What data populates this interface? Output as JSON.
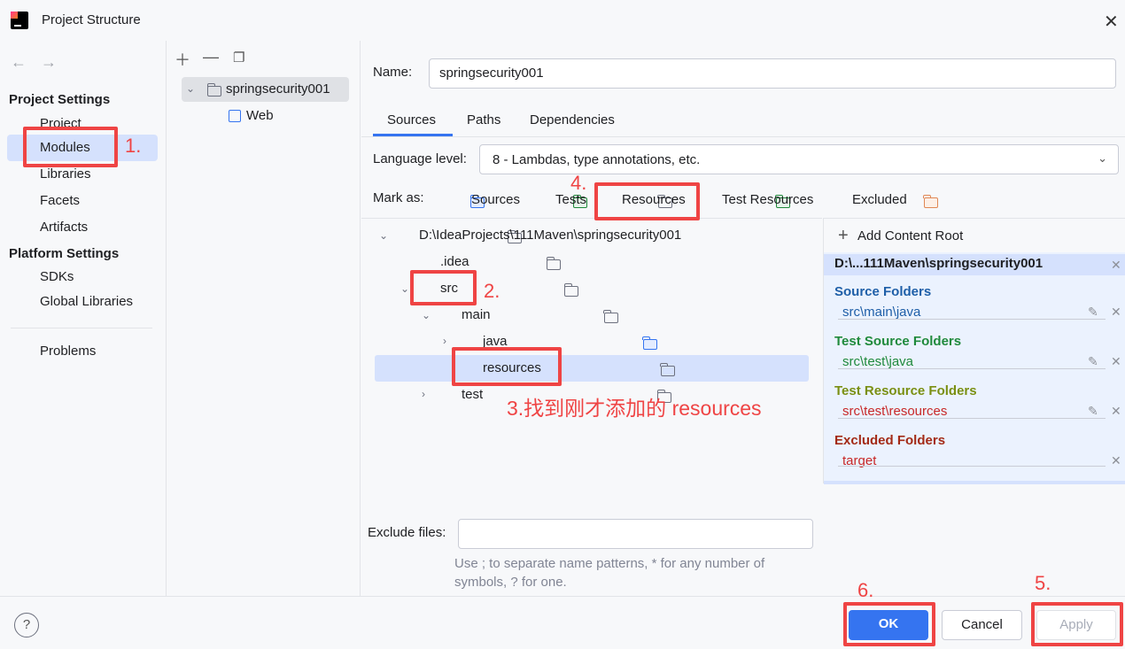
{
  "window": {
    "title": "Project Structure"
  },
  "sidebar": {
    "project_settings_heading": "Project Settings",
    "project_items": [
      "Project",
      "Modules",
      "Libraries",
      "Facets",
      "Artifacts"
    ],
    "platform_settings_heading": "Platform Settings",
    "platform_items": [
      "SDKs",
      "Global Libraries"
    ],
    "problems_label": "Problems"
  },
  "modules": {
    "tree": [
      {
        "label": "springsecurity001"
      },
      {
        "label": "Web"
      }
    ]
  },
  "detail": {
    "name_label": "Name:",
    "name_value": "springsecurity001",
    "tabs": [
      "Sources",
      "Paths",
      "Dependencies"
    ],
    "language_level_label": "Language level:",
    "language_level_value": "8 - Lambdas, type annotations, etc.",
    "mark_as_label": "Mark as:",
    "mark_as_buttons": [
      "Sources",
      "Tests",
      "Resources",
      "Test Resources",
      "Excluded"
    ],
    "file_tree": [
      {
        "label": "D:\\IdeaProjects\\111Maven\\springsecurity001"
      },
      {
        "label": ".idea"
      },
      {
        "label": "src"
      },
      {
        "label": "main"
      },
      {
        "label": "java"
      },
      {
        "label": "resources"
      },
      {
        "label": "test"
      }
    ],
    "exclude_files_label": "Exclude files:",
    "exclude_files_value": "",
    "exclude_hint_line1": "Use ; to separate name patterns, * for any number of",
    "exclude_hint_line2": "symbols, ? for one."
  },
  "content_roots": {
    "add_label": "Add Content Root",
    "root_path": "D:\\...111Maven\\springsecurity001",
    "categories": [
      {
        "title": "Source Folders",
        "path": "src\\main\\java",
        "color": "#1f5fa8"
      },
      {
        "title": "Test Source Folders",
        "path": "src\\test\\java",
        "color": "#208a3c"
      },
      {
        "title": "Test Resource Folders",
        "path": "src\\test\\resources",
        "color": "#7a8f12"
      },
      {
        "title": "Excluded Folders",
        "path": "target",
        "color": "#a32a16"
      }
    ],
    "path_colors": [
      "#1f5fa8",
      "#208a3c",
      "#c82828",
      "#c82828"
    ]
  },
  "footer": {
    "help_label": "?",
    "ok_label": "OK",
    "cancel_label": "Cancel",
    "apply_label": "Apply"
  },
  "annotations": {
    "step1": "1.",
    "step2": "2.",
    "step3": "3.找到刚才添加的 resources",
    "step4": "4.",
    "step5": "5.",
    "step6": "6."
  },
  "colors": {
    "accent": "#3574f0",
    "annotation_red": "#ef4444",
    "selection": "#d5e1fd"
  }
}
